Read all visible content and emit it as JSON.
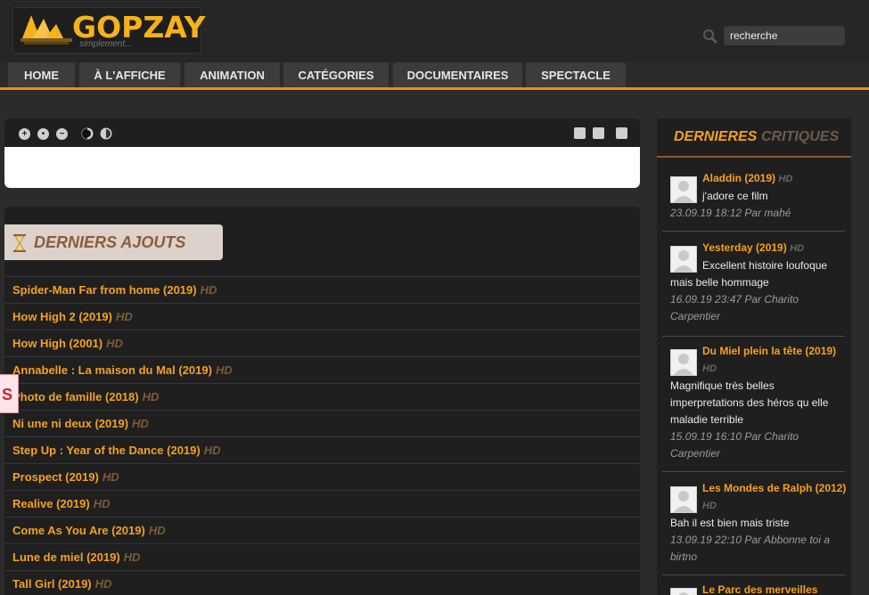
{
  "header": {
    "brand": "GOPZAY",
    "slogan": "simplement...",
    "search_value": "recherche"
  },
  "nav": {
    "tabs": [
      {
        "label": "HOME",
        "active": true
      },
      {
        "label": "À L'AFFICHE",
        "active": false
      },
      {
        "label": "ANIMATION",
        "active": false
      },
      {
        "label": "CATÉGORIES",
        "active": false
      },
      {
        "label": "DOCUMENTAIRES",
        "active": false
      },
      {
        "label": "SPECTACLE",
        "active": false
      }
    ]
  },
  "latest": {
    "heading": "DERNIERS AJOUTS",
    "side_tab": "S",
    "movies": [
      {
        "title": "Spider-Man Far from home (2019)",
        "badge": "HD"
      },
      {
        "title": "How High 2 (2019)",
        "badge": "HD"
      },
      {
        "title": "How High (2001)",
        "badge": "HD"
      },
      {
        "title": "Annabelle : La maison du Mal (2019)",
        "badge": "HD"
      },
      {
        "title": "Photo de famille (2018)",
        "badge": "HD"
      },
      {
        "title": "Ni une ni deux (2019)",
        "badge": "HD"
      },
      {
        "title": "Step Up : Year of the Dance (2019)",
        "badge": "HD"
      },
      {
        "title": "Prospect (2019)",
        "badge": "HD"
      },
      {
        "title": "Realive (2019)",
        "badge": "HD"
      },
      {
        "title": "Come As You Are (2019)",
        "badge": "HD"
      },
      {
        "title": "Lune de miel (2019)",
        "badge": "HD"
      },
      {
        "title": "Tall Girl (2019)",
        "badge": "HD"
      }
    ]
  },
  "reviews": {
    "heading_1": "DERNIERES",
    "heading_2": "CRITIQUES",
    "items": [
      {
        "title": "Aladdin (2019)",
        "badge": "HD",
        "comment": "j'adore ce film",
        "meta": "23.09.19 18:12 Par mahé"
      },
      {
        "title": "Yesterday (2019)",
        "badge": "HD",
        "comment": "Excellent histoire loufoque mais belle hommage",
        "meta": "16.09.19 23:47 Par Charito Carpentier"
      },
      {
        "title": "Du Miel plein la tête (2019)",
        "badge": "HD",
        "comment": "Magnifique très belles imperpretations des héros qu elle maladie terrible",
        "meta": "15.09.19 16:10 Par Charito Carpentier"
      },
      {
        "title": "Les Mondes de Ralph (2012)",
        "badge": "HD",
        "comment": "Bah il est bien mais triste",
        "meta": "13.09.19 22:10 Par Abbonne toi a birtno"
      },
      {
        "title": "Le Parc des merveilles",
        "badge": "",
        "comment": "",
        "meta": ""
      }
    ]
  },
  "colors": {
    "accent": "#f5a11e",
    "nav_line": "#f28c00",
    "background": "#2b2b2b"
  }
}
